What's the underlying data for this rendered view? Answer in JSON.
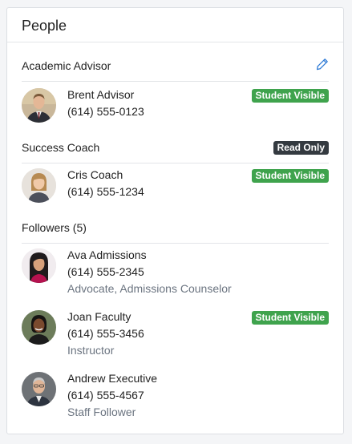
{
  "card": {
    "title": "People"
  },
  "advisor": {
    "title": "Academic Advisor",
    "edit_icon": "pencil-icon",
    "person": {
      "name": "Brent Advisor",
      "phone": "(614) 555-0123",
      "badge": "Student Visible"
    }
  },
  "coach": {
    "title": "Success Coach",
    "badge": "Read Only",
    "person": {
      "name": "Cris Coach",
      "phone": "(614) 555-1234",
      "badge": "Student Visible"
    }
  },
  "followers": {
    "title": "Followers (5)",
    "people": [
      {
        "name": "Ava Admissions",
        "phone": "(614) 555-2345",
        "role": "Advocate, Admissions Counselor"
      },
      {
        "name": "Joan Faculty",
        "phone": "(614) 555-3456",
        "role": "Instructor",
        "badge": "Student Visible"
      },
      {
        "name": "Andrew Executive",
        "phone": "(614) 555-4567",
        "role": "Staff Follower"
      }
    ]
  },
  "colors": {
    "student_visible": "#3fa34d",
    "read_only": "#343a40",
    "accent": "#2f7bd6"
  }
}
